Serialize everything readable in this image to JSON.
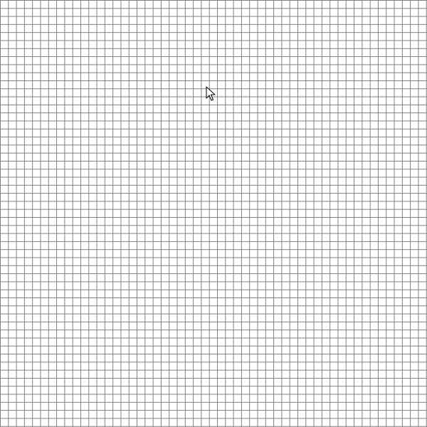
{
  "canvas": {
    "background_color": "#ffffff",
    "grid_line_color": "#7f7f7f",
    "grid": true
  },
  "cursor": {
    "icon": "arrow-pointer-icon"
  }
}
